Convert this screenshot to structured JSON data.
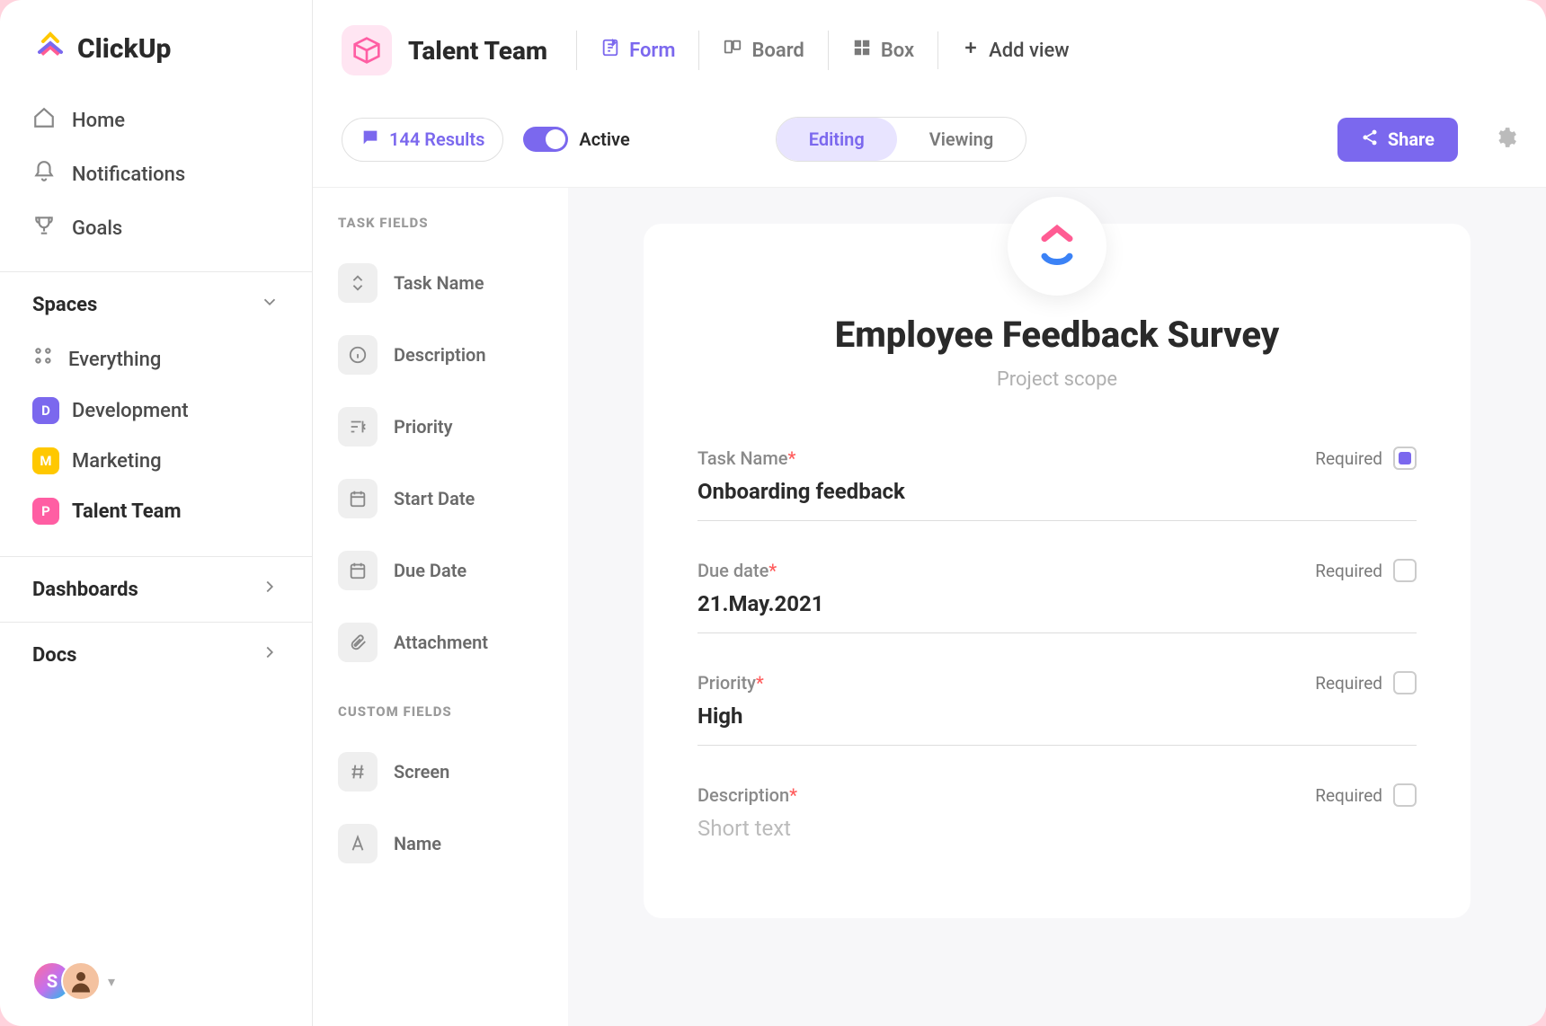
{
  "brand": "ClickUp",
  "sidebar": {
    "nav": [
      {
        "label": "Home"
      },
      {
        "label": "Notifications"
      },
      {
        "label": "Goals"
      }
    ],
    "spaces_header": "Spaces",
    "everything": "Everything",
    "spaces": [
      {
        "initial": "D",
        "label": "Development"
      },
      {
        "initial": "M",
        "label": "Marketing"
      },
      {
        "initial": "P",
        "label": "Talent Team"
      }
    ],
    "dashboards": "Dashboards",
    "docs": "Docs",
    "user_initial": "S"
  },
  "topbar": {
    "space_title": "Talent Team",
    "views": [
      {
        "label": "Form"
      },
      {
        "label": "Board"
      },
      {
        "label": "Box"
      }
    ],
    "add_view": "Add view"
  },
  "subbar": {
    "results": "144 Results",
    "active": "Active",
    "editing": "Editing",
    "viewing": "Viewing",
    "share": "Share"
  },
  "fields_panel": {
    "task_fields_heading": "TASK FIELDS",
    "task_fields": [
      "Task Name",
      "Description",
      "Priority",
      "Start Date",
      "Due Date",
      "Attachment"
    ],
    "custom_fields_heading": "CUSTOM FIELDS",
    "custom_fields": [
      "Screen",
      "Name"
    ]
  },
  "form": {
    "title": "Employee Feedback Survey",
    "subtitle": "Project scope",
    "required_label": "Required",
    "fields": [
      {
        "label": "Task Name",
        "value": "Onboarding feedback",
        "required_checked": true
      },
      {
        "label": "Due date",
        "value": "21.May.2021",
        "required_checked": false
      },
      {
        "label": "Priority",
        "value": "High",
        "required_checked": false
      },
      {
        "label": "Description",
        "placeholder": "Short text",
        "required_checked": false
      }
    ]
  }
}
